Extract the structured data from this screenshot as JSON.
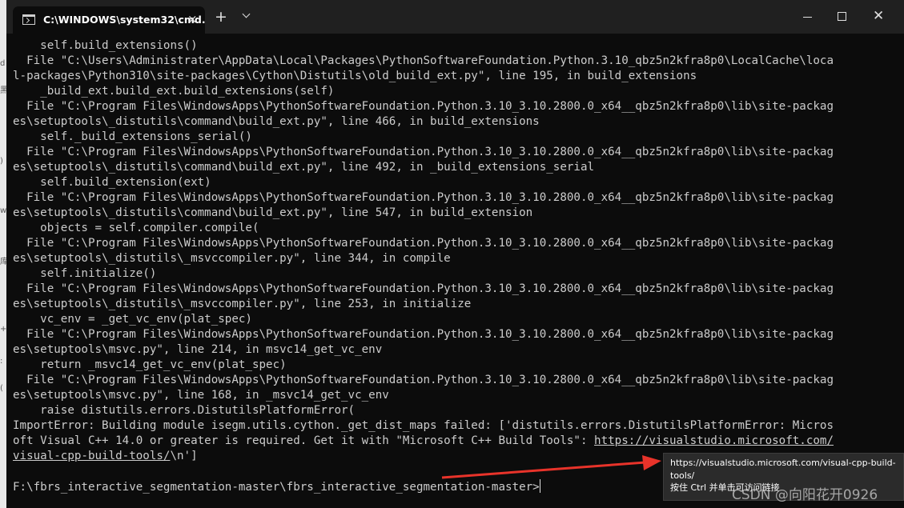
{
  "window": {
    "tab_title": "C:\\WINDOWS\\system32\\cmd.",
    "tab_close_icon": "×",
    "new_tab_icon": "+",
    "close_icon": "✕"
  },
  "console_lines": [
    "    self.build_extensions()",
    "  File \"C:\\Users\\Administrater\\AppData\\Local\\Packages\\PythonSoftwareFoundation.Python.3.10_qbz5n2kfra8p0\\LocalCache\\loca",
    "l-packages\\Python310\\site-packages\\Cython\\Distutils\\old_build_ext.py\", line 195, in build_extensions",
    "    _build_ext.build_ext.build_extensions(self)",
    "  File \"C:\\Program Files\\WindowsApps\\PythonSoftwareFoundation.Python.3.10_3.10.2800.0_x64__qbz5n2kfra8p0\\lib\\site-packag",
    "es\\setuptools\\_distutils\\command\\build_ext.py\", line 466, in build_extensions",
    "    self._build_extensions_serial()",
    "  File \"C:\\Program Files\\WindowsApps\\PythonSoftwareFoundation.Python.3.10_3.10.2800.0_x64__qbz5n2kfra8p0\\lib\\site-packag",
    "es\\setuptools\\_distutils\\command\\build_ext.py\", line 492, in _build_extensions_serial",
    "    self.build_extension(ext)",
    "  File \"C:\\Program Files\\WindowsApps\\PythonSoftwareFoundation.Python.3.10_3.10.2800.0_x64__qbz5n2kfra8p0\\lib\\site-packag",
    "es\\setuptools\\_distutils\\command\\build_ext.py\", line 547, in build_extension",
    "    objects = self.compiler.compile(",
    "  File \"C:\\Program Files\\WindowsApps\\PythonSoftwareFoundation.Python.3.10_3.10.2800.0_x64__qbz5n2kfra8p0\\lib\\site-packag",
    "es\\setuptools\\_distutils\\_msvccompiler.py\", line 344, in compile",
    "    self.initialize()",
    "  File \"C:\\Program Files\\WindowsApps\\PythonSoftwareFoundation.Python.3.10_3.10.2800.0_x64__qbz5n2kfra8p0\\lib\\site-packag",
    "es\\setuptools\\_distutils\\_msvccompiler.py\", line 253, in initialize",
    "    vc_env = _get_vc_env(plat_spec)",
    "  File \"C:\\Program Files\\WindowsApps\\PythonSoftwareFoundation.Python.3.10_3.10.2800.0_x64__qbz5n2kfra8p0\\lib\\site-packag",
    "es\\setuptools\\msvc.py\", line 214, in msvc14_get_vc_env",
    "    return _msvc14_get_vc_env(plat_spec)",
    "  File \"C:\\Program Files\\WindowsApps\\PythonSoftwareFoundation.Python.3.10_3.10.2800.0_x64__qbz5n2kfra8p0\\lib\\site-packag",
    "es\\setuptools\\msvc.py\", line 168, in _msvc14_get_vc_env",
    "    raise distutils.errors.DistutilsPlatformError(",
    "ImportError: Building module isegm.utils.cython._get_dist_maps failed: ['distutils.errors.DistutilsPlatformError: Micros"
  ],
  "error_line2_prefix": "oft Visual C++ 14.0 or greater is required. Get it with \"Microsoft C++ Build Tools\": ",
  "link_part1": "https://visualstudio.microsoft.com/",
  "link_part2": "visual-cpp-build-tools/",
  "error_line3_suffix": "\\n']",
  "prompt": "F:\\fbrs_interactive_segmentation-master\\fbrs_interactive_segmentation-master>",
  "tooltip": {
    "url_line1": "https://visualstudio.microsoft.com/visual-cpp-build-",
    "url_line2": "tools/",
    "hint": "按住 Ctrl 并单击可访问链接"
  },
  "watermark": "CSDN @向阳花开0926",
  "background_fragments": [
    "d",
    "黑",
    ")",
    "w",
    "库",
    "+",
    ":",
    "("
  ],
  "colors": {
    "console_bg": "#0c0c0c",
    "console_fg": "#cccccc",
    "titlebar": "#202020",
    "arrow": "#e8332a"
  }
}
